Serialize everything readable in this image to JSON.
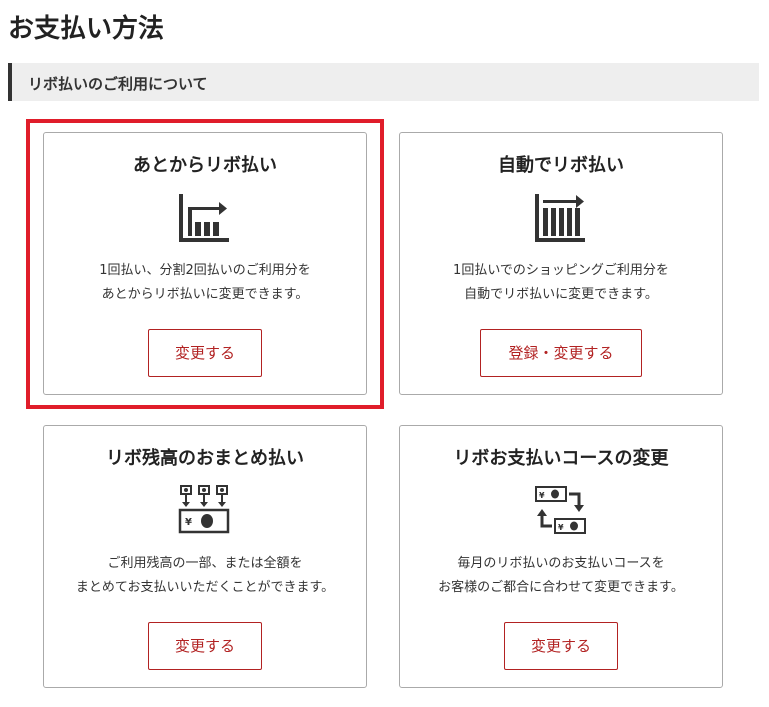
{
  "page": {
    "title": "お支払い方法"
  },
  "section": {
    "title": "リボ払いのご利用について"
  },
  "colors": {
    "accent": "#b22222",
    "highlight": "#e01d2a"
  },
  "cards": [
    {
      "title": "あとからリボ払い",
      "icon": "bar-chart-icon",
      "desc_line1": "1回払い、分割2回払いのご利用分を",
      "desc_line2": "あとからリボ払いに変更できます。",
      "button": "変更する"
    },
    {
      "title": "自動でリボ払い",
      "icon": "bar-chart-icon",
      "desc_line1": "1回払いでのショッピングご利用分を",
      "desc_line2": "自動でリボ払いに変更できます。",
      "button": "登録・変更する"
    },
    {
      "title": "リボ残高のおまとめ払い",
      "icon": "lump-sum-payment-icon",
      "desc_line1": "ご利用残高の一部、または全額を",
      "desc_line2": "まとめてお支払いいただくことができます。",
      "button": "変更する"
    },
    {
      "title": "リボお支払いコースの変更",
      "icon": "course-exchange-icon",
      "desc_line1": "毎月のリボ払いのお支払いコースを",
      "desc_line2": "お客様のご都合に合わせて変更できます。",
      "button": "変更する"
    }
  ]
}
